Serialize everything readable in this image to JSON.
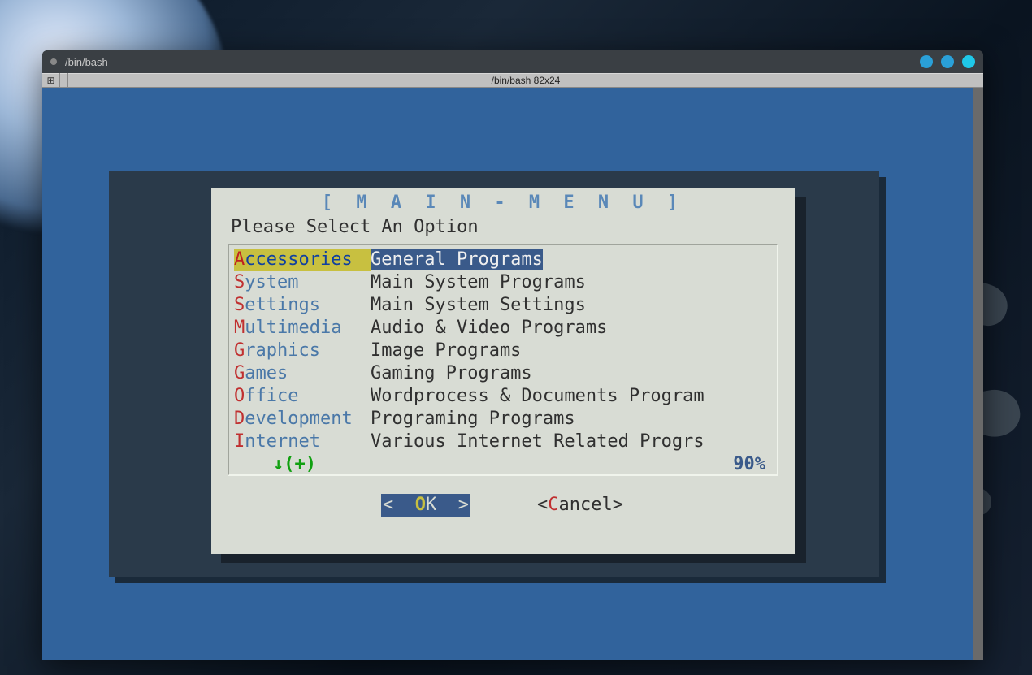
{
  "window": {
    "title": "/bin/bash",
    "toolbar_title": "/bin/bash 82x24"
  },
  "dialog": {
    "title_open": "[",
    "title_text": " M A I N - M E N U ",
    "title_close": "]",
    "prompt": "Please Select An Option",
    "scroll_arrow": "↓(+)",
    "scroll_percent": "90%",
    "items": [
      {
        "hotkey": "A",
        "rest": "ccessories",
        "desc": "General Programs",
        "selected": true
      },
      {
        "hotkey": "S",
        "rest": "ystem",
        "desc": "Main System Programs",
        "selected": false
      },
      {
        "hotkey": "S",
        "rest": "ettings",
        "desc": "Main System Settings",
        "selected": false
      },
      {
        "hotkey": "M",
        "rest": "ultimedia",
        "desc": "Audio & Video Programs",
        "selected": false
      },
      {
        "hotkey": "G",
        "rest": "raphics",
        "desc": "Image Programs",
        "selected": false
      },
      {
        "hotkey": "G",
        "rest": "ames",
        "desc": "Gaming Programs",
        "selected": false
      },
      {
        "hotkey": "O",
        "rest": "ffice",
        "desc": "Wordprocess & Documents Program",
        "selected": false
      },
      {
        "hotkey": "D",
        "rest": "evelopment",
        "desc": "Programing Programs",
        "selected": false
      },
      {
        "hotkey": "I",
        "rest": "nternet",
        "desc": "Various Internet Related Progrs",
        "selected": false
      }
    ],
    "buttons": {
      "ok": {
        "open": "<  ",
        "hotkey": "O",
        "rest": "K",
        "close": "  >",
        "selected": true
      },
      "cancel": {
        "open": "<",
        "hotkey": "C",
        "rest": "ancel",
        "close": ">",
        "selected": false
      }
    }
  }
}
